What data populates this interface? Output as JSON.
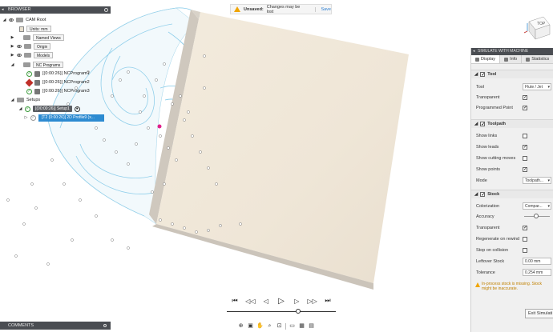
{
  "browser": {
    "title": "BROWSER",
    "items": [
      {
        "label": "CAM Root"
      },
      {
        "label": "Units: mm"
      },
      {
        "label": "Named Views"
      },
      {
        "label": "Origin"
      },
      {
        "label": "Models"
      },
      {
        "label": "NC Programs"
      },
      {
        "label": "[(0:00:26)] NCProgram1"
      },
      {
        "label": "[(0:00:26)] NCProgram2"
      },
      {
        "label": "[(0:00:26)] NCProgram3"
      },
      {
        "label": "Setups"
      },
      {
        "label": "[(00:00:26)] Setup1"
      },
      {
        "label": "[T2 (0:00:26)] 2D Profile9 (x..."
      }
    ]
  },
  "notification": {
    "title": "Unsaved:",
    "message": "Changes may be lost",
    "action": "Save"
  },
  "viewcube": {
    "label": "TOP"
  },
  "sim_panel": {
    "title": "SIMULATE WITH MACHINE",
    "tabs": [
      {
        "label": "Display",
        "active": true
      },
      {
        "label": "Info",
        "active": false
      },
      {
        "label": "Statistics",
        "active": false
      }
    ],
    "tool": {
      "title": "Tool",
      "tool_label": "Tool",
      "tool_value": "Flute / Jet",
      "transparent_label": "Transparent",
      "programmed_point_label": "Programmed Point"
    },
    "toolpath": {
      "title": "Toolpath",
      "show_links": "Show links",
      "show_leads": "Show leads",
      "show_cutting_moves": "Show cutting moves",
      "show_points": "Show points",
      "mode_label": "Mode",
      "mode_value": "Toolpath..."
    },
    "stock": {
      "title": "Stock",
      "colorization_label": "Colorization",
      "colorization_value": "Compar...",
      "accuracy_label": "Accuracy",
      "accuracy_level": 0.45,
      "transparent_label": "Transparent",
      "regenerate_label": "Regenerate on rewind",
      "stop_label": "Stop on collision",
      "leftover_label": "Leftover Stock",
      "leftover_value": "0.00 mm",
      "tolerance_label": "Tolerance",
      "tolerance_value": "0.254 mm",
      "warning": "In-process stock is missing. Stock might be inaccurate."
    },
    "exit_label": "Exit Simulati"
  },
  "playback": {
    "position": 0.66
  },
  "comments": {
    "title": "COMMENTS"
  },
  "colors": {
    "stock": "#efe6d8",
    "toolpath": "#7fc8e8",
    "accent": "#2d8bd1",
    "marker": "#e0208c"
  }
}
